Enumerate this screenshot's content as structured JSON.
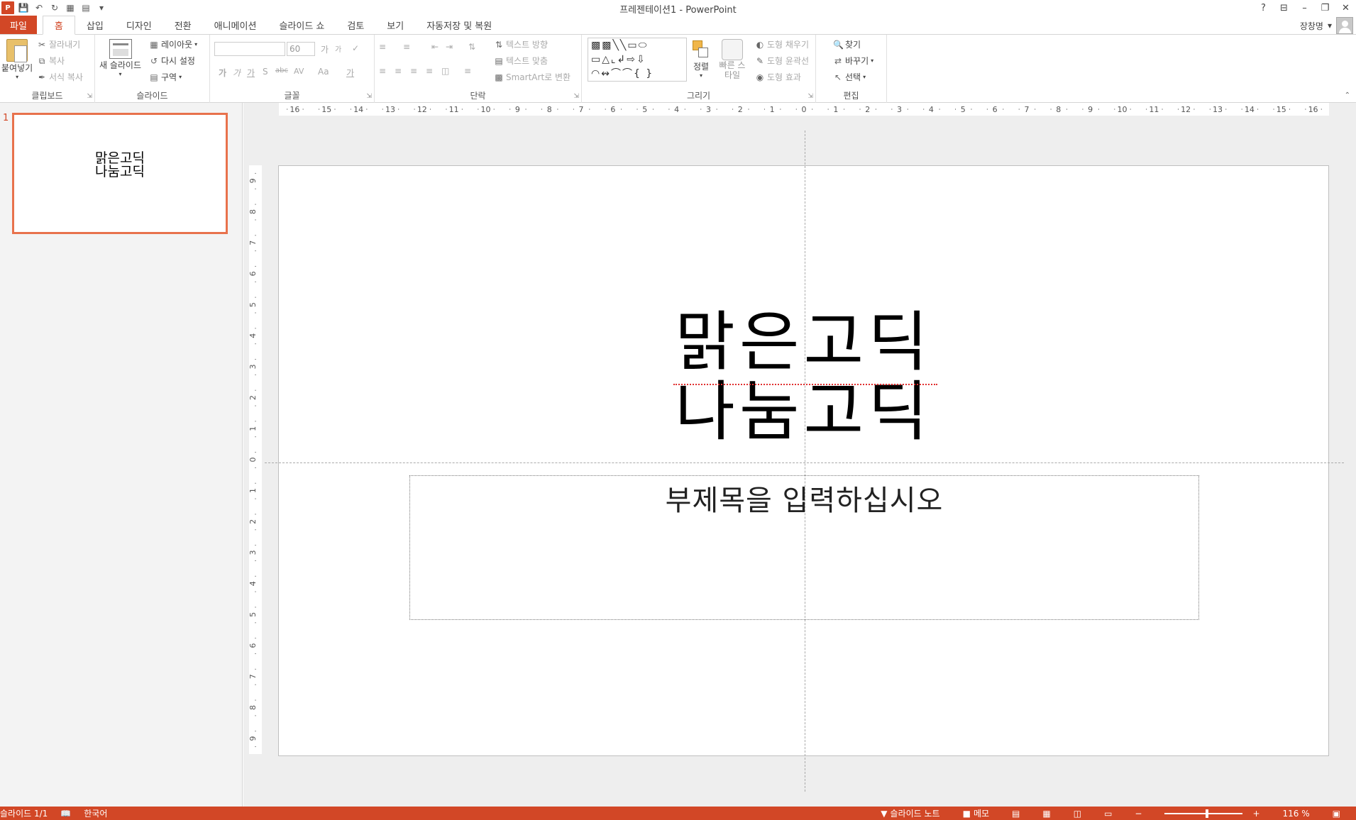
{
  "window": {
    "title": "프레젠테이션1 - PowerPoint",
    "app_logo": "P"
  },
  "qat": {
    "icons": [
      "save-icon",
      "undo-icon",
      "redo-icon",
      "new-slide-icon",
      "start-icon",
      "customize-icon"
    ]
  },
  "window_controls": {
    "help": "?",
    "ribbon_display": "⊟",
    "minimize": "–",
    "restore": "❐",
    "close": "✕"
  },
  "tabs": [
    {
      "label": "파일"
    },
    {
      "label": "홈"
    },
    {
      "label": "삽입"
    },
    {
      "label": "디자인"
    },
    {
      "label": "전환"
    },
    {
      "label": "애니메이션"
    },
    {
      "label": "슬라이드 쇼"
    },
    {
      "label": "검토"
    },
    {
      "label": "보기"
    },
    {
      "label": "자동저장 및 복원"
    }
  ],
  "account": {
    "name": "장창명"
  },
  "ribbon": {
    "clipboard": {
      "label": "클립보드",
      "paste": "붙여넣기",
      "cut": "잘라내기",
      "copy": "복사",
      "format_painter": "서식 복사"
    },
    "slides": {
      "label": "슬라이드",
      "new_slide": "새 슬라이드",
      "layout": "레이아웃",
      "reset": "다시 설정",
      "section": "구역"
    },
    "font": {
      "label": "글꼴",
      "font_name": "",
      "font_size": "60",
      "grow": "가",
      "shrink": "가",
      "bold": "가",
      "italic": "가",
      "underline": "가",
      "shadow": "S",
      "strike": "abc",
      "spacing": "AV",
      "case": "Aa",
      "color": "가"
    },
    "paragraph": {
      "label": "단락",
      "text_direction": "텍스트 방향",
      "align_text": "텍스트 맞춤",
      "smartart": "SmartArt로 변환"
    },
    "drawing": {
      "label": "그리기",
      "arrange": "정렬",
      "quick_styles": "빠른 스타일",
      "shape_fill": "도형 채우기",
      "shape_outline": "도형 윤곽선",
      "shape_effects": "도형 효과"
    },
    "editing": {
      "label": "편집",
      "find": "찾기",
      "replace": "바꾸기",
      "select": "선택"
    }
  },
  "thumbnails": [
    {
      "number": "1",
      "line1": "맑은고딕",
      "line2": "나눔고딕"
    }
  ],
  "rulers": {
    "horizontal": [
      "16",
      "15",
      "14",
      "13",
      "12",
      "11",
      "10",
      "9",
      "8",
      "7",
      "6",
      "5",
      "4",
      "3",
      "2",
      "1",
      "0",
      "1",
      "2",
      "3",
      "4",
      "5",
      "6",
      "7",
      "8",
      "9",
      "10",
      "11",
      "12",
      "13",
      "14",
      "15",
      "16"
    ],
    "vertical": [
      "9",
      "8",
      "7",
      "6",
      "5",
      "4",
      "3",
      "2",
      "1",
      "0",
      "1",
      "2",
      "3",
      "4",
      "5",
      "6",
      "7",
      "8",
      "9"
    ]
  },
  "slide": {
    "title_line1": "맑은고딕",
    "title_line2": "나눔고딕",
    "subtitle_placeholder": "부제목을 입력하십시오"
  },
  "status": {
    "slide_counter": "슬라이드 1/1",
    "language": "한국어",
    "notes": "슬라이드 노트",
    "comments": "메모",
    "zoom_level": "116 %",
    "zoom_fraction": 0.54,
    "colors": {
      "accent": "#d24726",
      "selection": "#e8724c"
    }
  }
}
